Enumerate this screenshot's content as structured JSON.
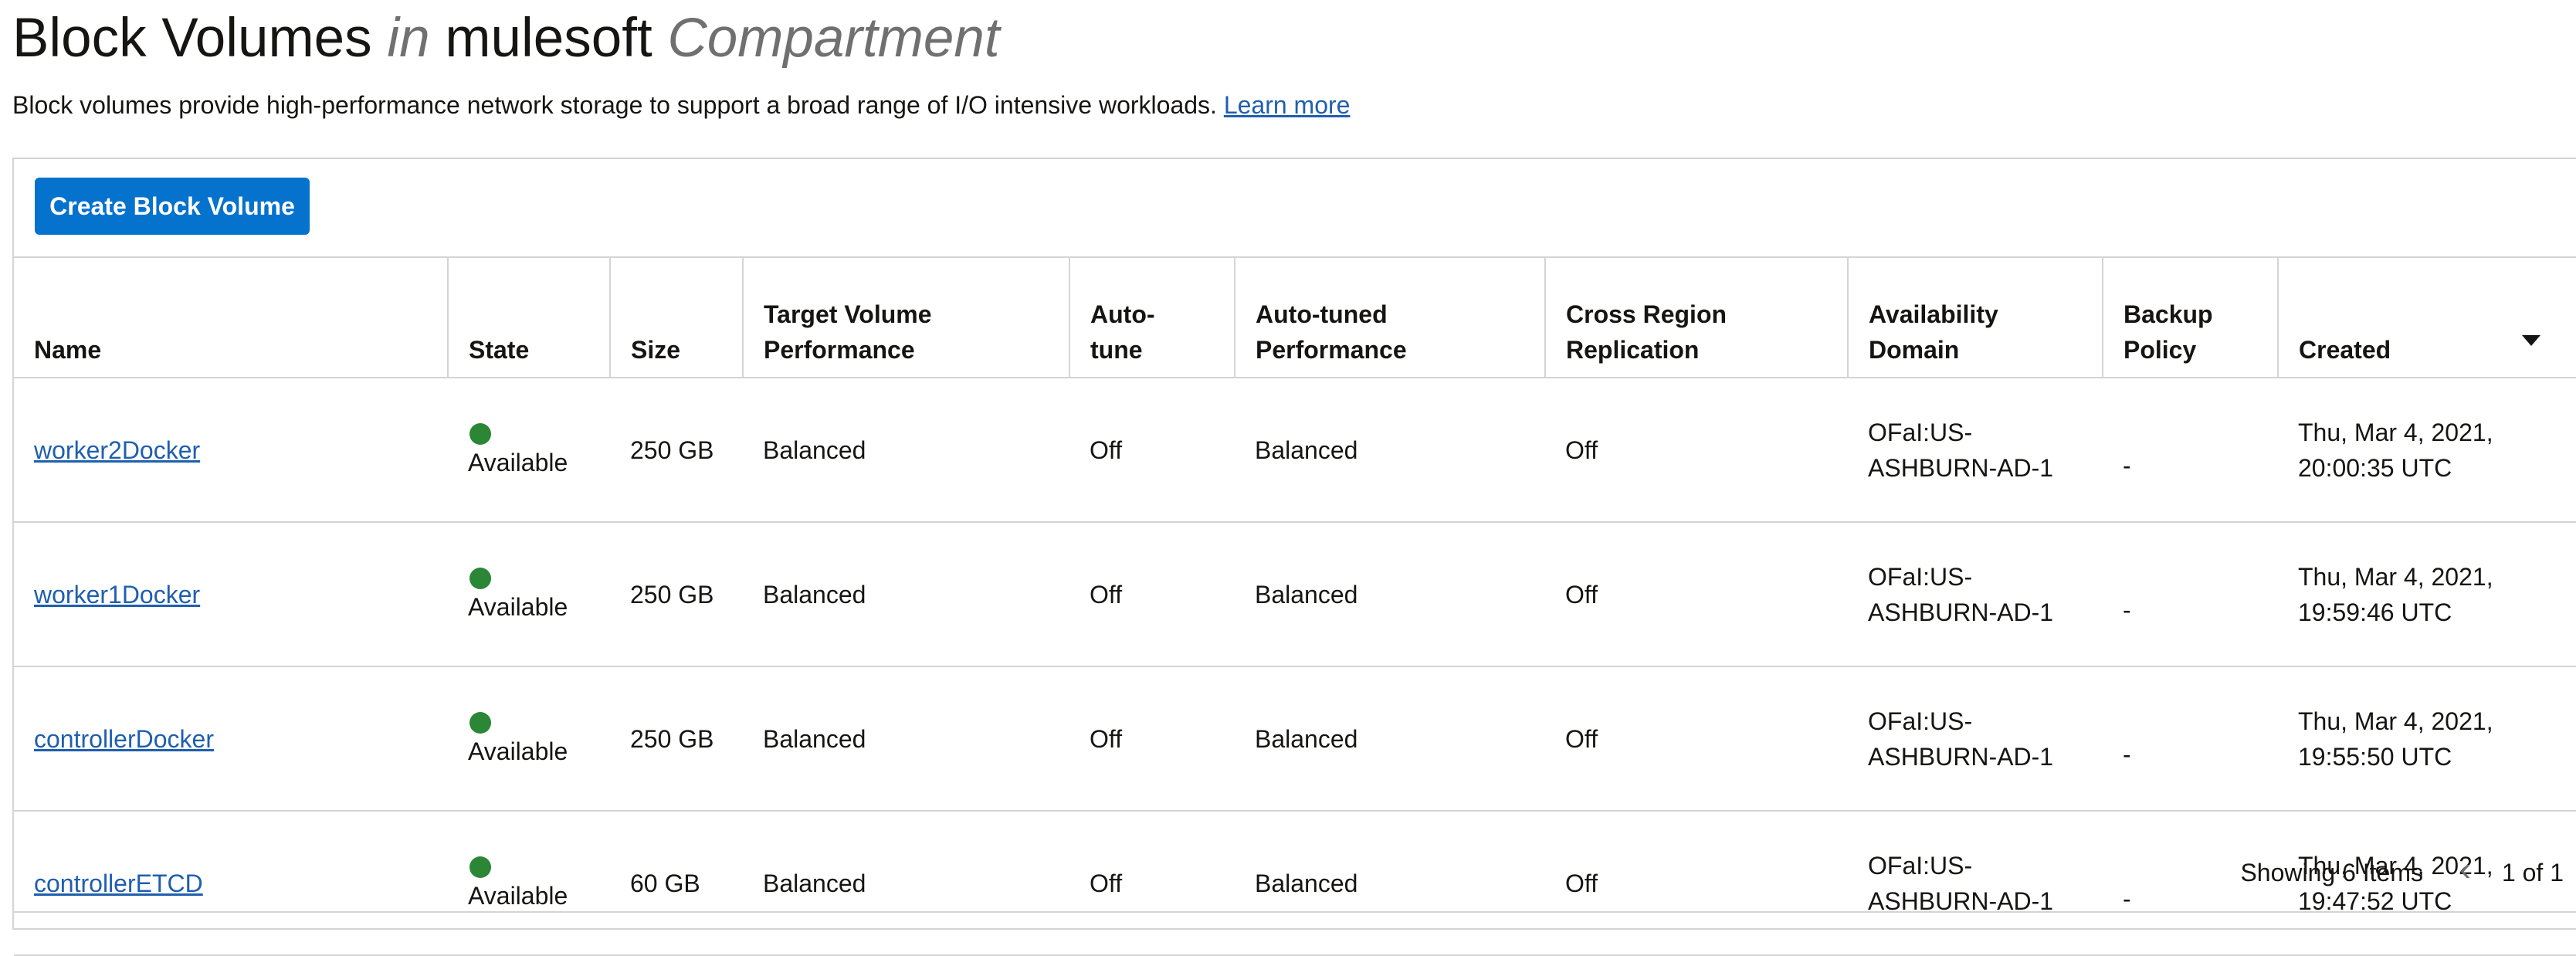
{
  "header": {
    "title_main": "Block Volumes",
    "title_in": "in",
    "title_compartment_name": "mulesoft",
    "title_compartment_word": "Compartment",
    "description": "Block volumes provide high-performance network storage to support a broad range of I/O intensive workloads.",
    "learn_more": "Learn more"
  },
  "toolbar": {
    "create_label": "Create Block Volume"
  },
  "table": {
    "columns": [
      [
        "Name"
      ],
      [
        "State"
      ],
      [
        "Size"
      ],
      [
        "Target Volume",
        "Performance"
      ],
      [
        "Auto-",
        "tune"
      ],
      [
        "Auto-tuned",
        "Performance"
      ],
      [
        "Cross Region",
        "Replication"
      ],
      [
        "Availability",
        "Domain"
      ],
      [
        "Backup",
        "Policy"
      ],
      [
        "Created"
      ]
    ],
    "rows": [
      {
        "name": "worker2Docker",
        "state": "Available",
        "size": "250 GB",
        "target_perf": "Balanced",
        "auto_tune": "Off",
        "auto_tuned_perf": "Balanced",
        "replication": "Off",
        "ad_line1": "OFaI:US-",
        "ad_line2": "ASHBURN-AD-1",
        "backup": "-",
        "created_line1": "Thu, Mar 4, 2021,",
        "created_line2": "20:00:35 UTC"
      },
      {
        "name": "worker1Docker",
        "state": "Available",
        "size": "250 GB",
        "target_perf": "Balanced",
        "auto_tune": "Off",
        "auto_tuned_perf": "Balanced",
        "replication": "Off",
        "ad_line1": "OFaI:US-",
        "ad_line2": "ASHBURN-AD-1",
        "backup": "-",
        "created_line1": "Thu, Mar 4, 2021,",
        "created_line2": "19:59:46 UTC"
      },
      {
        "name": "controllerDocker",
        "state": "Available",
        "size": "250 GB",
        "target_perf": "Balanced",
        "auto_tune": "Off",
        "auto_tuned_perf": "Balanced",
        "replication": "Off",
        "ad_line1": "OFaI:US-",
        "ad_line2": "ASHBURN-AD-1",
        "backup": "-",
        "created_line1": "Thu, Mar 4, 2021,",
        "created_line2": "19:55:50 UTC"
      },
      {
        "name": "controllerETCD",
        "state": "Available",
        "size": "60 GB",
        "target_perf": "Balanced",
        "auto_tune": "Off",
        "auto_tuned_perf": "Balanced",
        "replication": "Off",
        "ad_line1": "OFaI:US-",
        "ad_line2": "ASHBURN-AD-1",
        "backup": "-",
        "created_line1": "Thu, Mar 4, 2021,",
        "created_line2": "19:47:52 UTC"
      }
    ]
  },
  "pagination": {
    "count_text": "Showing 6 Items",
    "page_text": "1 of 1"
  },
  "colors": {
    "accent": "#0572ce",
    "link": "#1f5fae",
    "available": "#2b8635"
  }
}
